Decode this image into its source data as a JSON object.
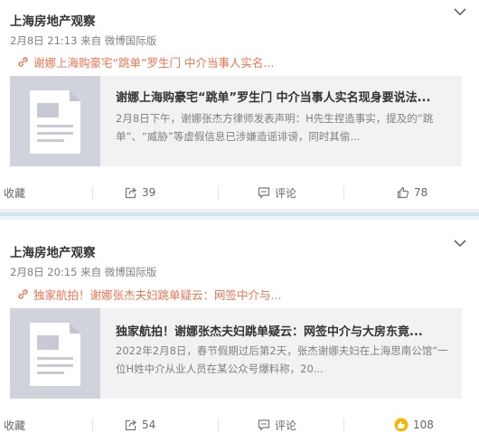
{
  "posts": [
    {
      "author": "上海房地产观察",
      "time": "2月8日 21:13",
      "source": "来自 微博国际版",
      "link_text": "谢娜上海购豪宅“跳单”罗生门 中介当事人实名...",
      "card_title": "谢娜上海购豪宅“跳单”罗生门 中介当事人实名现身要说法...",
      "card_desc": "2月8日下午，谢娜张杰方律师发表声明：H先生捏造事实，提及的“跳单”、“威胁”等虚假信息已涉嫌造谣诽谤，同时其偷...",
      "actions": {
        "favorite": "收藏",
        "repost": "39",
        "comment": "评论",
        "like": "78"
      }
    },
    {
      "author": "上海房地产观察",
      "time": "2月8日 20:15",
      "source": "来自 微博国际版",
      "link_text": "独家航拍！谢娜张杰夫妇跳单疑云：网签中介与...",
      "card_title": "独家航拍！谢娜张杰夫妇跳单疑云：网签中介与大房东竟...",
      "card_desc": "2022年2月8日，春节假期过后第2天，张杰谢娜夫妇在上海思南公馆“一位H姓中介从业人员在某公众号爆料称，20...",
      "actions": {
        "favorite": "收藏",
        "repost": "54",
        "comment": "评论",
        "like": "108"
      }
    }
  ],
  "colors": {
    "link": "#eb7350",
    "separator": "#cfe4f6",
    "card_bg": "#f2f2f5",
    "thumb_bg": "#d0d2dc",
    "liked_icon": "#f7b500"
  },
  "icons": [
    "chevron-down-icon",
    "link-icon",
    "document-thumbnail",
    "repost-icon",
    "comment-icon",
    "thumb-up-icon"
  ]
}
